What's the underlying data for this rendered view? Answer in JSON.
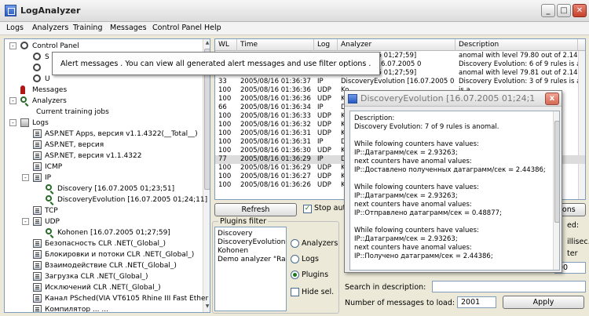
{
  "window": {
    "title": "LogAnalyzer"
  },
  "menu": [
    "Logs",
    "Analyzers",
    "Training",
    "Messages",
    "Control Panel",
    "Help"
  ],
  "tree": [
    {
      "label": "Control Panel",
      "indent": 0,
      "expander": "-",
      "icon": "ring",
      "icon_name": "control-panel-icon"
    },
    {
      "label": "S",
      "indent": 1,
      "expander": "",
      "icon": "ring",
      "icon_name": "settings-icon"
    },
    {
      "label": "",
      "indent": 1,
      "expander": "",
      "icon": "ring",
      "icon_name": "config-icon"
    },
    {
      "label": "U",
      "indent": 1,
      "expander": "",
      "icon": "ring",
      "icon_name": "users-icon"
    },
    {
      "label": "Messages",
      "indent": 0,
      "expander": "",
      "icon": "pin",
      "icon_name": "messages-icon"
    },
    {
      "label": "Analyzers",
      "indent": 0,
      "expander": "-",
      "icon": "mag",
      "icon_name": "analyzers-icon"
    },
    {
      "label": "Current training jobs",
      "indent": 1,
      "expander": "",
      "icon": "",
      "icon_name": ""
    },
    {
      "label": "Logs",
      "indent": 0,
      "expander": "-",
      "icon": "tool",
      "icon_name": "logs-icon"
    },
    {
      "label": "ASP.NET Apps, версия v1.1.4322(__Total__)",
      "indent": 1,
      "expander": "",
      "icon": "doc",
      "icon_name": "log-icon"
    },
    {
      "label": "ASP.NET, версия",
      "indent": 1,
      "expander": "",
      "icon": "doc",
      "icon_name": "log-icon"
    },
    {
      "label": "ASP.NET, версия v1.1.4322",
      "indent": 1,
      "expander": "",
      "icon": "doc",
      "icon_name": "log-icon"
    },
    {
      "label": "ICMP",
      "indent": 1,
      "expander": "",
      "icon": "doc",
      "icon_name": "log-icon"
    },
    {
      "label": "IP",
      "indent": 1,
      "expander": "-",
      "icon": "doc",
      "icon_name": "log-icon"
    },
    {
      "label": "Discovery [16.07.2005 01;23;51]",
      "indent": 2,
      "expander": "",
      "icon": "mag",
      "icon_name": "analyzer-icon"
    },
    {
      "label": "DiscoveryEvolution [16.07.2005 01;24;11]",
      "indent": 2,
      "expander": "",
      "icon": "mag",
      "icon_name": "analyzer-icon"
    },
    {
      "label": "TCP",
      "indent": 1,
      "expander": "",
      "icon": "doc",
      "icon_name": "log-icon"
    },
    {
      "label": "UDP",
      "indent": 1,
      "expander": "-",
      "icon": "doc",
      "icon_name": "log-icon"
    },
    {
      "label": "Kohonen [16.07.2005 01;27;59]",
      "indent": 2,
      "expander": "",
      "icon": "mag",
      "icon_name": "analyzer-icon"
    },
    {
      "label": "Безопасность CLR .NET(_Global_)",
      "indent": 1,
      "expander": "",
      "icon": "doc",
      "icon_name": "log-icon"
    },
    {
      "label": "Блокировки и потоки CLR .NET(_Global_)",
      "indent": 1,
      "expander": "",
      "icon": "doc",
      "icon_name": "log-icon"
    },
    {
      "label": "Взаимодействие CLR .NET(_Global_)",
      "indent": 1,
      "expander": "",
      "icon": "doc",
      "icon_name": "log-icon"
    },
    {
      "label": "Загрузка CLR .NET(_Global_)",
      "indent": 1,
      "expander": "",
      "icon": "doc",
      "icon_name": "log-icon"
    },
    {
      "label": "Исключений CLR .NET(_Global_)",
      "indent": 1,
      "expander": "",
      "icon": "doc",
      "icon_name": "log-icon"
    },
    {
      "label": "Канал PSched(VIA VT6105 Rhine III Fast Ether",
      "indent": 1,
      "expander": "",
      "icon": "doc",
      "icon_name": "log-icon"
    },
    {
      "label": "Компилятор ... ...",
      "indent": 1,
      "expander": "",
      "icon": "doc",
      "icon_name": "log-icon"
    }
  ],
  "list": {
    "headers": [
      "WL",
      "Time",
      "Log",
      "Analyzer",
      "Description"
    ],
    "rows": [
      {
        "wl": "",
        "time": "",
        "log": "",
        "analyzer": "[16.07.2005 01;27;59]",
        "desc": "anomal with level 79.80 out of 2.14",
        "sel": false
      },
      {
        "wl": "",
        "time": "",
        "log": "",
        "analyzer": "Evolution [16.07.2005 0",
        "desc": "Discovery Evolution: 6 of 9 rules is a",
        "sel": false
      },
      {
        "wl": "",
        "time": "",
        "log": "",
        "analyzer": "[16.07.2005 01;27;59]",
        "desc": "anomal with level 79.81 out of 2.14",
        "sel": false
      },
      {
        "wl": "33",
        "time": "2005/08/16 01:36:37",
        "log": "IP",
        "analyzer": "DiscoveryEvolution [16.07.2005 0",
        "desc": "Discovery Evolution: 3 of 9 rules is a",
        "sel": false
      },
      {
        "wl": "100",
        "time": "2005/08/16 01:36:36",
        "log": "UDP",
        "analyzer": "Ko",
        "desc": "is a",
        "sel": false
      },
      {
        "wl": "100",
        "time": "2005/08/16 01:36:36",
        "log": "UDP",
        "analyzer": "Ko",
        "desc": "is a",
        "sel": false
      },
      {
        "wl": "66",
        "time": "2005/08/16 01:36:34",
        "log": "IP",
        "analyzer": "Di",
        "desc": "is a",
        "sel": false
      },
      {
        "wl": "100",
        "time": "2005/08/16 01:36:33",
        "log": "UDP",
        "analyzer": "Ko",
        "desc": "is a",
        "sel": false
      },
      {
        "wl": "100",
        "time": "2005/08/16 01:36:32",
        "log": "UDP",
        "analyzer": "Ko",
        "desc": "is a",
        "sel": false
      },
      {
        "wl": "100",
        "time": "2005/08/16 01:36:31",
        "log": "UDP",
        "analyzer": "Ko",
        "desc": "is a",
        "sel": false
      },
      {
        "wl": "100",
        "time": "2005/08/16 01:36:31",
        "log": "IP",
        "analyzer": "Di",
        "desc": "is a",
        "sel": false
      },
      {
        "wl": "100",
        "time": "2005/08/16 01:36:30",
        "log": "UDP",
        "analyzer": "Ko",
        "desc": "is a",
        "sel": false
      },
      {
        "wl": "77",
        "time": "2005/08/16 01:36:29",
        "log": "IP",
        "analyzer": "Di",
        "desc": "is a",
        "sel": true
      },
      {
        "wl": "100",
        "time": "2005/08/16 01:36:29",
        "log": "UDP",
        "analyzer": "Ko",
        "desc": "is a",
        "sel": false
      },
      {
        "wl": "100",
        "time": "2005/08/16 01:36:27",
        "log": "UDP",
        "analyzer": "Ko",
        "desc": "is a",
        "sel": false
      },
      {
        "wl": "100",
        "time": "2005/08/16 01:36:26",
        "log": "UDP",
        "analyzer": "Ko",
        "desc": "is a",
        "sel": false
      }
    ]
  },
  "tooltip": {
    "text": "Alert messages . You can view all generated alert messages and use filter options ."
  },
  "popup": {
    "title": "DiscoveryEvolution [16.07.2005 01;24;1",
    "lines": [
      "Description:",
      "Discovery Evolution: 7 of 9 rules is anomal.",
      "",
      "While folowing counters have values:",
      "IP::Датаграмм/сек = 2.93263;",
      "next counters have anomal values:",
      "IP::Доставлено полученных датаграмм/сек = 2.44386;",
      "",
      "While folowing counters have values:",
      "IP::Датаграмм/сек = 2.93263;",
      "next counters have anomal values:",
      "IP::Отправлено датаграмм/сек = 0.48877;",
      "",
      "While folowing counters have values:",
      "IP::Датаграмм/сек = 2.93263;",
      "next counters have anomal values:",
      "IP::Получено датаграмм/сек = 2.44386;"
    ],
    "close_label": "x"
  },
  "controls": {
    "refresh_label": "Refresh",
    "stop_auto_label": "Stop auto",
    "stop_auto_checked": true,
    "plugins_filter_label": "Plugins filter",
    "plugins": [
      "Discovery",
      "DiscoveryEvolution",
      "Kohonen",
      "Demo analyzer \"Rand"
    ],
    "radios": [
      {
        "label": "Analyzers",
        "checked": false
      },
      {
        "label": "Logs",
        "checked": false
      },
      {
        "label": "Plugins",
        "checked": true
      }
    ],
    "hide_sel_label": "Hide sel.",
    "search_label": "Search in description:",
    "search_value": "",
    "count_label": "Number of messages to load:",
    "count_value": "2001",
    "apply_label": "Apply",
    "options_label": "ions",
    "side_labels": [
      "ed:",
      "illisec.",
      "ter"
    ],
    "side_value": "00"
  }
}
